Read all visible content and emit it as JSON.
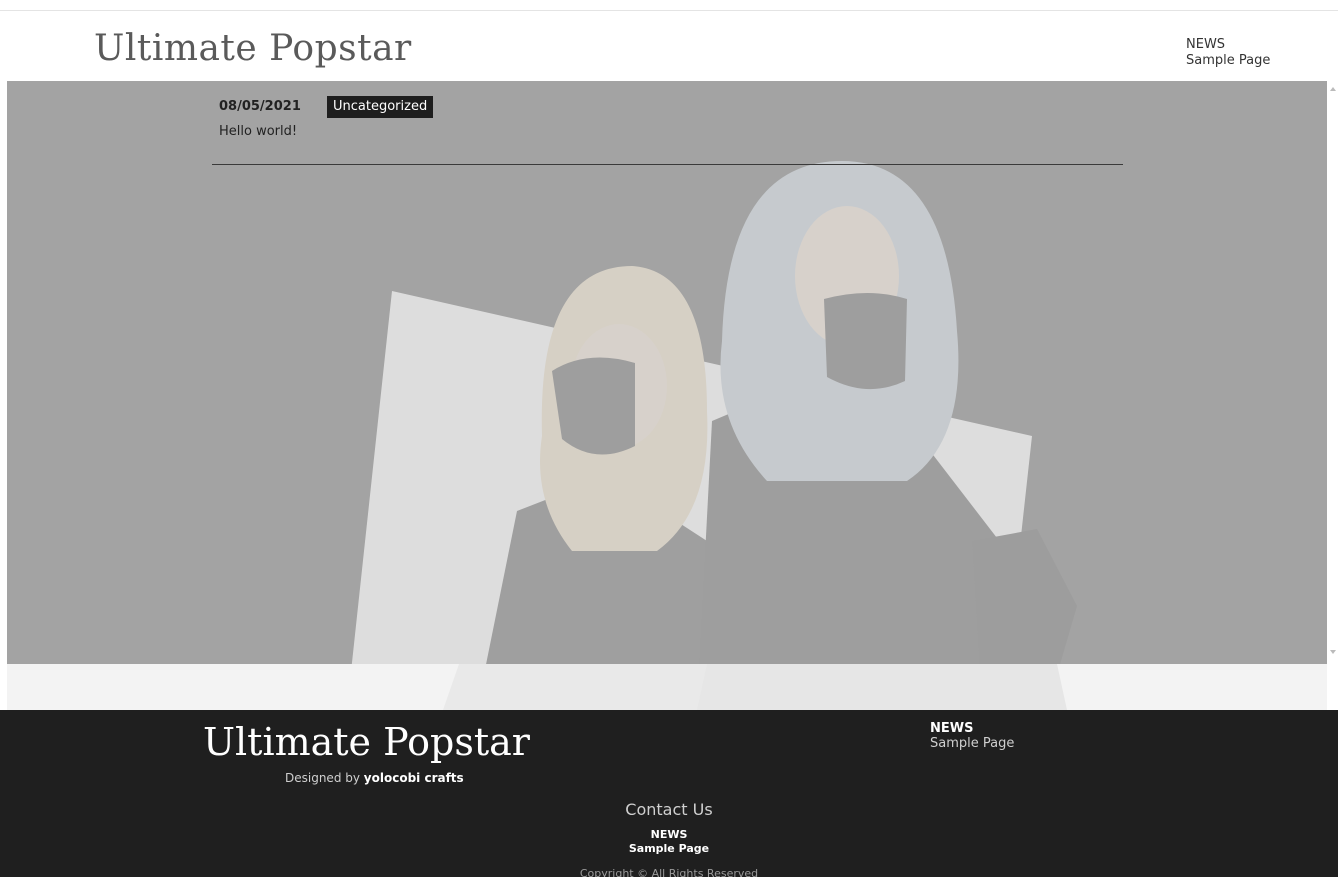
{
  "header": {
    "site_title": "Ultimate Popstar",
    "nav": [
      "NEWS",
      "Sample Page"
    ]
  },
  "post": {
    "date": "08/05/2021",
    "category": "Uncategorized",
    "title": "Hello world!"
  },
  "footer": {
    "site_title": "Ultimate Popstar",
    "credit_prefix": "Designed by",
    "credit_name": "yolocobi crafts",
    "nav": [
      "NEWS",
      "Sample Page"
    ],
    "contact_title": "Contact Us",
    "contact_nav": [
      "NEWS",
      "Sample Page"
    ],
    "copyright": "Copyright © All Rights Reserved"
  },
  "colors": {
    "footer_background": "#1f1f1f",
    "hero_overlay": "#d6d6d6",
    "category_badge": "#1e1e1e"
  }
}
